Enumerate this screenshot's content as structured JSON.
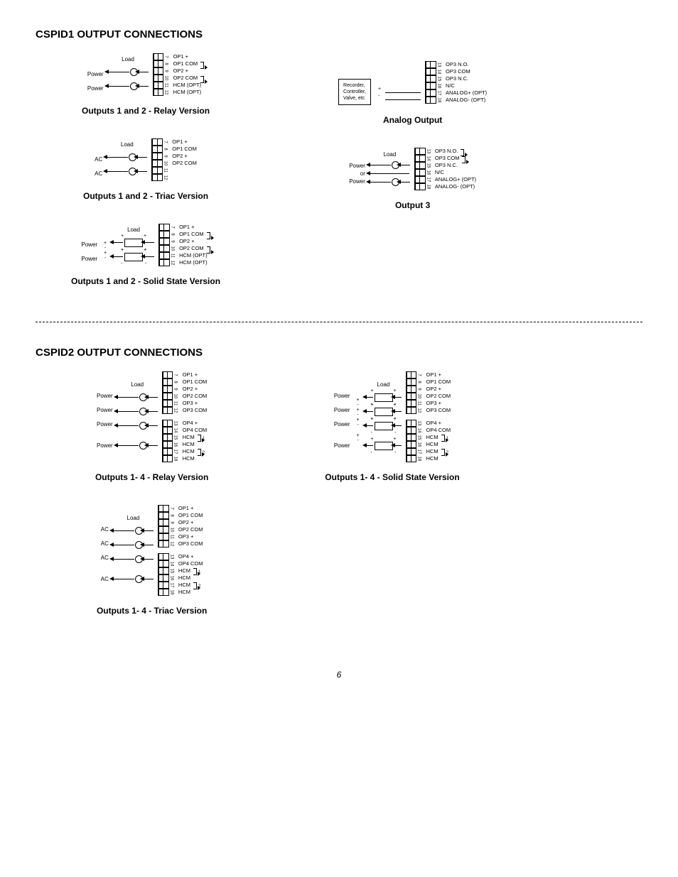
{
  "page_number": "6",
  "section1": {
    "title": "CSPID1 OUTPUT CONNECTIONS"
  },
  "section2": {
    "title": "CSPID2 OUTPUT CONNECTIONS"
  },
  "common": {
    "load": "Load",
    "power": "Power",
    "ac": "AC",
    "power_or": "or",
    "source1": "Recorder,",
    "source2": "Controller,",
    "source3": "Valve, etc"
  },
  "d1": {
    "caption": "Outputs 1 and 2 - Relay Version",
    "terms": {
      "t7": "7",
      "t8": "8",
      "t9": "9",
      "t10": "10",
      "t11": "11",
      "t12": "12"
    },
    "labels": {
      "l1": "OP1 +",
      "l2": "OP1 COM",
      "l3": "OP2 +",
      "l4": "OP2 COM",
      "l5": "HCM (OPT)",
      "l6": "HCM (OPT)"
    }
  },
  "d2": {
    "caption": "Outputs 1 and 2 - Triac Version",
    "terms": {
      "t7": "7",
      "t8": "8",
      "t9": "9",
      "t10": "10",
      "t11": "11",
      "t12": "12"
    },
    "labels": {
      "l1": "OP1 +",
      "l2": "OP1 COM",
      "l3": "OP2 +",
      "l4": "OP2 COM"
    }
  },
  "d3": {
    "caption": "Outputs 1 and 2 - Solid State Version",
    "terms": {
      "t7": "7",
      "t8": "8",
      "t9": "9",
      "t10": "10",
      "t11": "11",
      "t12": "12"
    },
    "labels": {
      "l1": "OP1 +",
      "l2": "OP1 COM",
      "l3": "OP2 +",
      "l4": "OP2 COM",
      "l5": "HCM (OPT)",
      "l6": "HCM (OPT)"
    }
  },
  "d4": {
    "caption": "Analog Output",
    "terms": {
      "t13": "13",
      "t14": "14",
      "t15": "15",
      "t16": "16",
      "t17": "17",
      "t18": "18"
    },
    "labels": {
      "l1": "OP3 N.O.",
      "l2": "OP3 COM",
      "l3": "OP3 N.C.",
      "l4": "N/C",
      "l5": "ANALOG+ (OPT)",
      "l6": "ANALOG- (OPT)"
    }
  },
  "d5": {
    "caption": "Output 3",
    "terms": {
      "t13": "13",
      "t14": "14",
      "t15": "15",
      "t16": "16",
      "t17": "17",
      "t18": "18"
    },
    "labels": {
      "l1": "OP3 N.O.",
      "l2": "OP3 COM",
      "l3": "OP3 N.C.",
      "l4": "N/C",
      "l5": "ANALOG+ (OPT)",
      "l6": "ANALOG- (OPT)"
    }
  },
  "d6": {
    "caption": "Outputs 1- 4 - Relay Version",
    "terms": {
      "t7": "7",
      "t8": "8",
      "t9": "9",
      "t10": "10",
      "t11": "11",
      "t12": "12",
      "t13": "13",
      "t14": "14",
      "t15": "15",
      "t16": "16",
      "t17": "17",
      "t18": "18"
    },
    "labels": {
      "l1": "OP1 +",
      "l2": "OP1 COM",
      "l3": "OP2 +",
      "l4": "OP2 COM",
      "l5": "OP3 +",
      "l6": "OP3 COM",
      "l7": "OP4 +",
      "l8": "OP4 COM",
      "l9": "HCM",
      "l10": "HCM",
      "l11": "HCM",
      "l12": "HCM"
    },
    "annot": {
      "a1": "1",
      "a2": "2"
    }
  },
  "d7": {
    "caption": "Outputs 1- 4 - Solid State Version",
    "terms": {
      "t7": "7",
      "t8": "8",
      "t9": "9",
      "t10": "10",
      "t11": "11",
      "t12": "12",
      "t13": "13",
      "t14": "14",
      "t15": "15",
      "t16": "16",
      "t17": "17",
      "t18": "18"
    },
    "labels": {
      "l1": "OP1 +",
      "l2": "OP1 COM",
      "l3": "OP2 +",
      "l4": "OP2 COM",
      "l5": "OP3 +",
      "l6": "OP3 COM",
      "l7": "OP4 +",
      "l8": "OP4 COM",
      "l9": "HCM",
      "l10": "HCM",
      "l11": "HCM",
      "l12": "HCM"
    },
    "annot": {
      "a1": "1",
      "a2": "2"
    }
  },
  "d8": {
    "caption": "Outputs 1- 4 - Triac Version",
    "terms": {
      "t7": "7",
      "t8": "8",
      "t9": "9",
      "t10": "10",
      "t11": "11",
      "t12": "12",
      "t13": "13",
      "t14": "14",
      "t15": "15",
      "t16": "16",
      "t17": "17",
      "t18": "18"
    },
    "labels": {
      "l1": "OP1 +",
      "l2": "OP1 COM",
      "l3": "OP2 +",
      "l4": "OP2 COM",
      "l5": "OP3 +",
      "l6": "OP3 COM",
      "l7": "OP4 +",
      "l8": "OP4 COM",
      "l9": "HCM",
      "l10": "HCM",
      "l11": "HCM",
      "l12": "HCM"
    },
    "annot": {
      "a1": "1",
      "a2": "2"
    }
  }
}
